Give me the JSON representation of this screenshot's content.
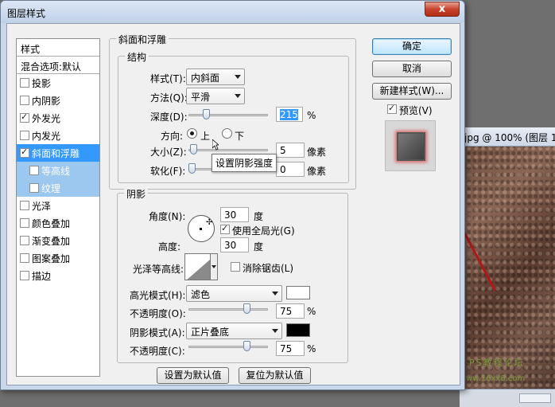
{
  "background_window": {
    "title": "jpg @ 100% (图层 1,",
    "watermark": "PS教程论坛",
    "url_watermark": "www.16xx8.com"
  },
  "dialog": {
    "title": "图层样式",
    "close_glyph": "x"
  },
  "sidebar": {
    "header": "样式",
    "blend_options": "混合选项:默认",
    "items": [
      {
        "label": "投影",
        "checked": false,
        "selected": false
      },
      {
        "label": "内阴影",
        "checked": false,
        "selected": false
      },
      {
        "label": "外发光",
        "checked": true,
        "selected": false
      },
      {
        "label": "内发光",
        "checked": false,
        "selected": false
      },
      {
        "label": "斜面和浮雕",
        "checked": true,
        "selected": true
      },
      {
        "label": "等高线",
        "checked": false,
        "selected": false,
        "sub": true
      },
      {
        "label": "纹理",
        "checked": false,
        "selected": false,
        "sub": true
      },
      {
        "label": "光泽",
        "checked": false,
        "selected": false
      },
      {
        "label": "颜色叠加",
        "checked": false,
        "selected": false
      },
      {
        "label": "渐变叠加",
        "checked": false,
        "selected": false
      },
      {
        "label": "图案叠加",
        "checked": false,
        "selected": false
      },
      {
        "label": "描边",
        "checked": false,
        "selected": false
      }
    ]
  },
  "bevel": {
    "section_title": "斜面和浮雕",
    "structure_title": "结构",
    "style_label": "样式(T):",
    "style_value": "内斜面",
    "technique_label": "方法(Q):",
    "technique_value": "平滑",
    "depth_label": "深度(D):",
    "depth_value": "215",
    "depth_unit": "%",
    "depth_slider": 0.2,
    "direction_label": "方向:",
    "direction_up": "上",
    "direction_down": "下",
    "size_label": "大小(Z):",
    "size_value": "5",
    "size_unit": "像素",
    "size_slider": 0.02,
    "soften_label": "软化(F):",
    "soften_value": "0",
    "soften_unit": "像素",
    "soften_slider": 0.0,
    "tooltip": "设置阴影强度"
  },
  "shading": {
    "title": "阴影",
    "angle_label": "角度(N):",
    "angle_value": "30",
    "angle_unit": "度",
    "global_light_label": "使用全局光(G)",
    "global_light_checked": true,
    "altitude_label": "高度:",
    "altitude_value": "30",
    "altitude_unit": "度",
    "gloss_label": "光泽等高线:",
    "antialias_label": "消除锯齿(L)",
    "antialias_checked": false,
    "highlight_mode_label": "高光模式(H):",
    "highlight_mode_value": "滤色",
    "highlight_color": "#ffffff",
    "highlight_opacity_label": "不透明度(O):",
    "highlight_opacity_value": "75",
    "highlight_opacity_unit": "%",
    "highlight_opacity_slider": 0.75,
    "shadow_mode_label": "阴影模式(A):",
    "shadow_mode_value": "正片叠底",
    "shadow_color": "#000000",
    "shadow_opacity_label": "不透明度(C):",
    "shadow_opacity_value": "75",
    "shadow_opacity_unit": "%",
    "shadow_opacity_slider": 0.75
  },
  "footer": {
    "make_default": "设置为默认值",
    "reset_default": "复位为默认值"
  },
  "actions": {
    "ok": "确定",
    "cancel": "取消",
    "new_style": "新建样式(W)...",
    "preview_label": "预览(V)",
    "preview_checked": true
  }
}
